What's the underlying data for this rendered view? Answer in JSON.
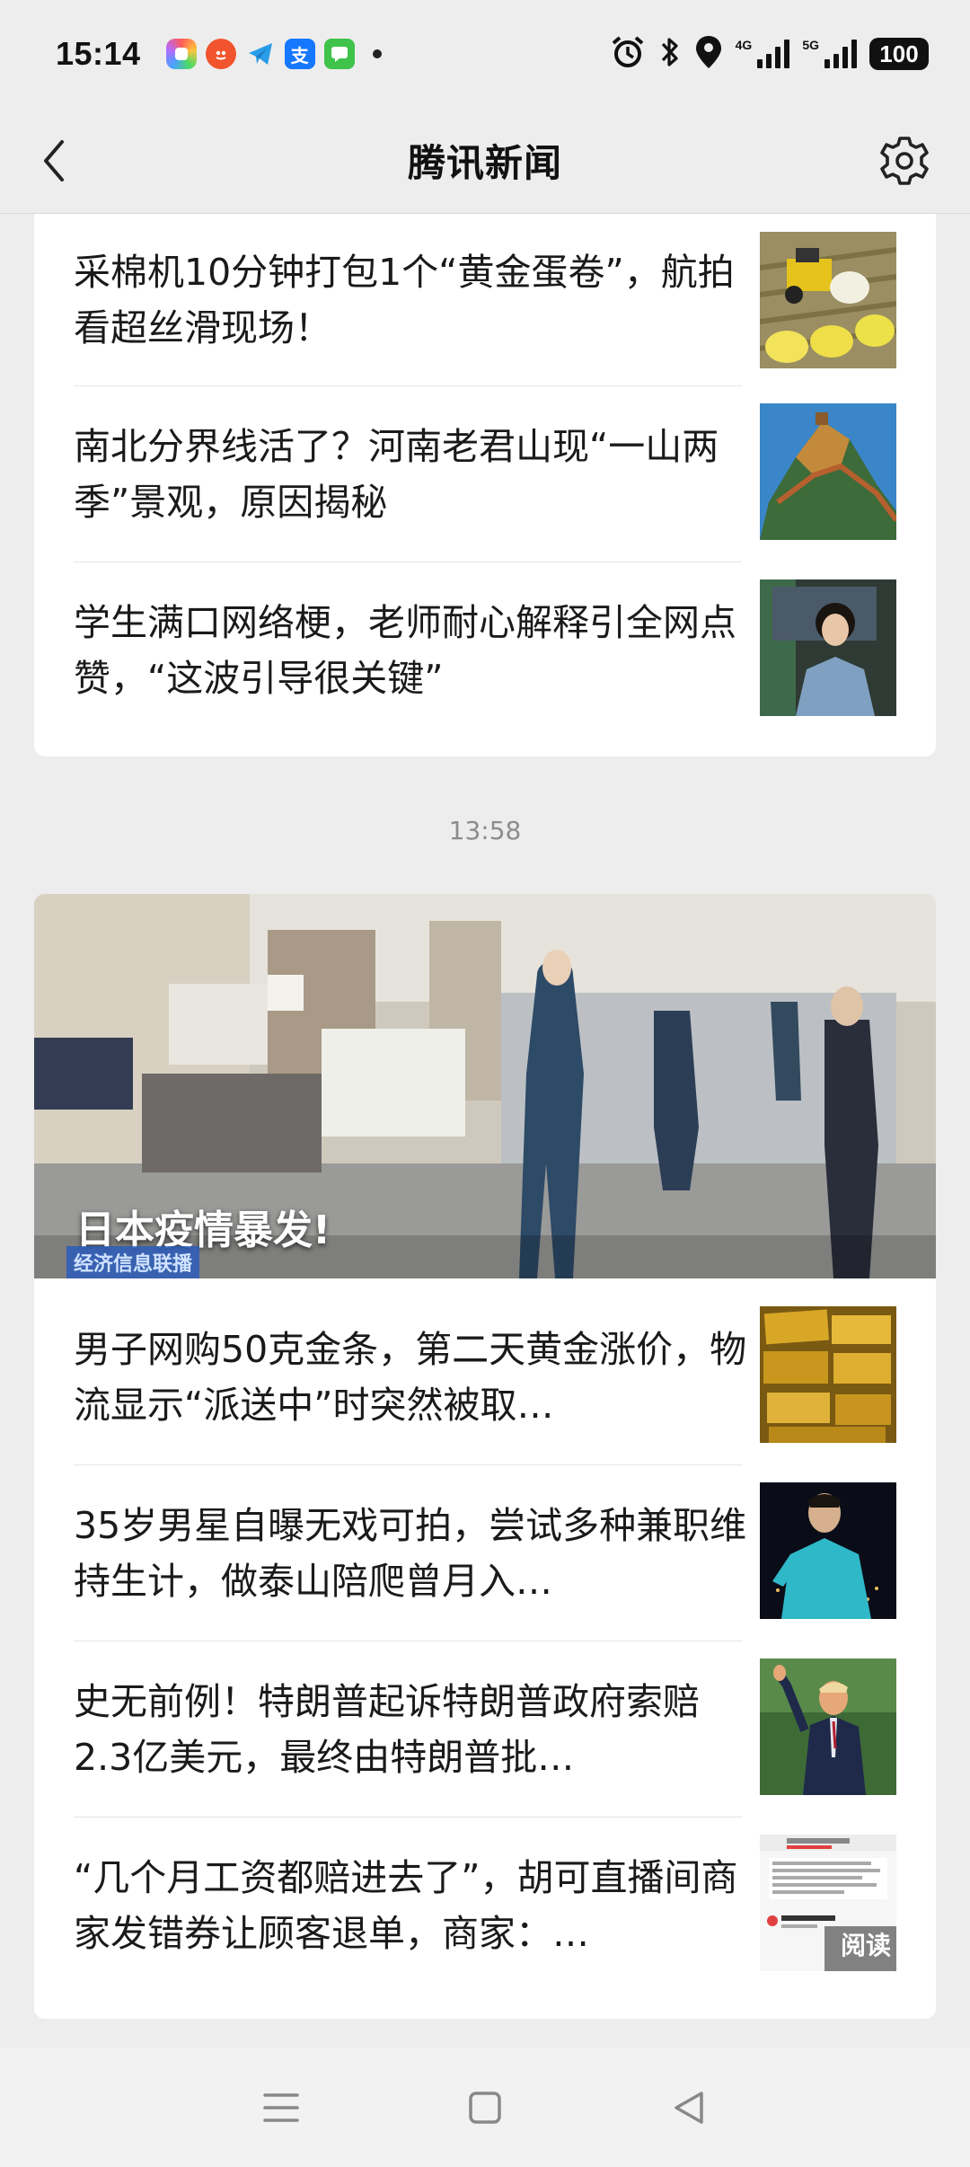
{
  "status_bar": {
    "time": "15:14",
    "apps": [
      "app-multicolor-icon",
      "app-orange-icon",
      "telegram-icon",
      "alipay-icon",
      "message-icon"
    ],
    "alipay_glyph": "支",
    "network_1": "4G",
    "network_2": "5G",
    "battery": "100"
  },
  "header": {
    "title": "腾讯新闻"
  },
  "top_card": {
    "items": [
      {
        "title": "采棉机10分钟打包1个“黄金蛋卷”，航拍看超丝滑现场！"
      },
      {
        "title": "南北分界线活了？河南老君山现“一山两季”景观，原因揭秘"
      },
      {
        "title": "学生满口网络梗，老师耐心解释引全网点赞，“这波引导很关键”"
      }
    ]
  },
  "time_label": "13:58",
  "bottom_card": {
    "hero": {
      "title": "日本疫情暴发!",
      "ticker": "经济信息联播"
    },
    "items": [
      {
        "title": "男子网购50克金条，第二天黄金涨价，物流显示“派送中”时突然被取…"
      },
      {
        "title": "35岁男星自曝无戏可拍，尝试多种兼职维持生计，做泰山陪爬曾月入…"
      },
      {
        "title": "史无前例！特朗普起诉特朗普政府索赔2.3亿美元，最终由特朗普批…"
      },
      {
        "title": "“几个月工资都赔进去了”，胡可直播间商家发错券让顾客退单，商家：…",
        "thumb_overlay": "阅读"
      }
    ]
  },
  "nav_bar": {
    "buttons": [
      "menu-icon",
      "home-square-icon",
      "back-triangle-icon"
    ]
  },
  "colors": {
    "background": "#ededed",
    "card": "#ffffff",
    "text": "#1a1a1a",
    "time_label": "#8c8c8c"
  }
}
